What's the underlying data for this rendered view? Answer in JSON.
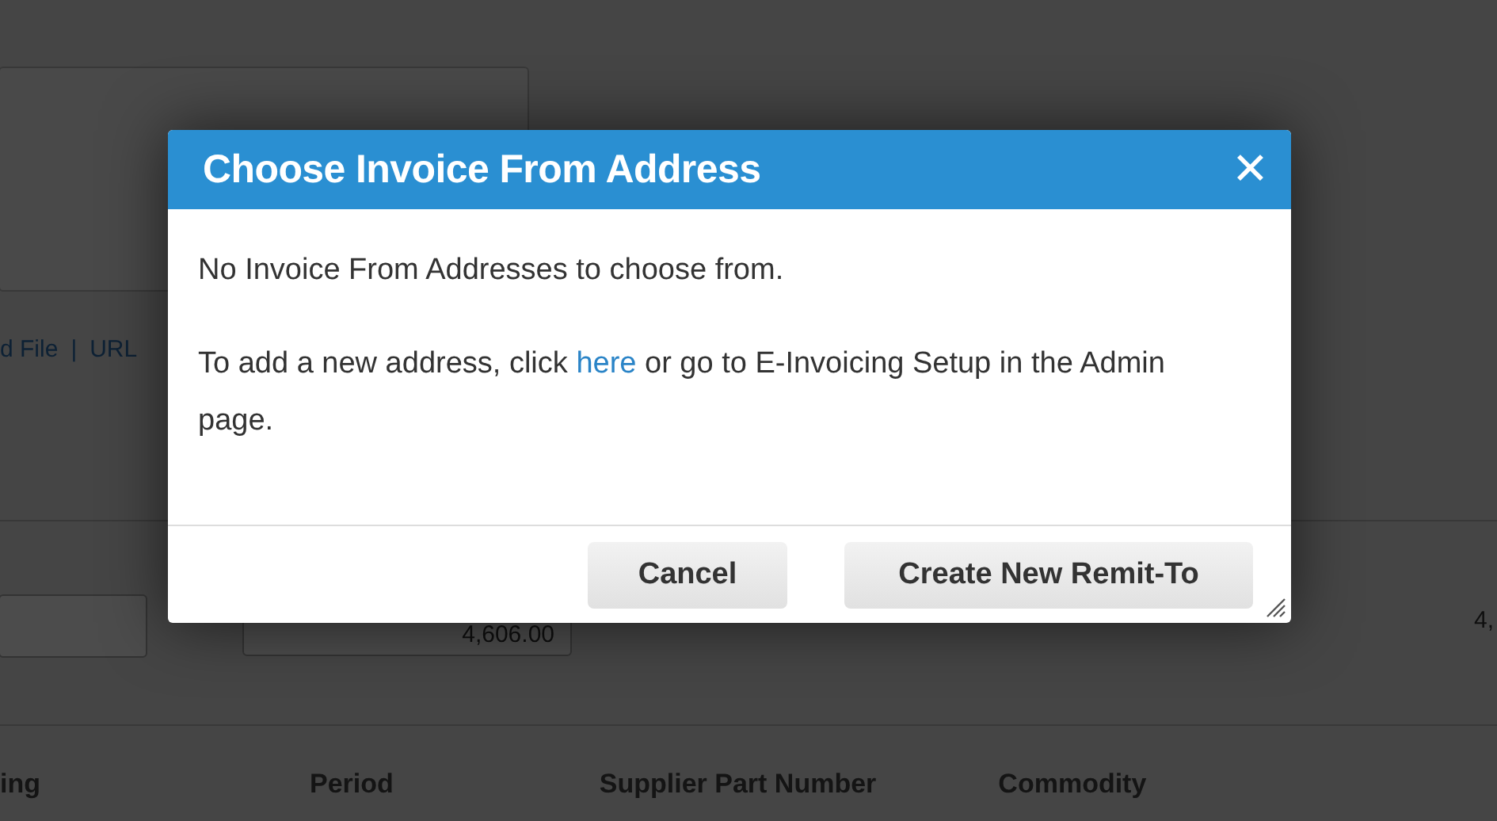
{
  "background": {
    "links": [
      {
        "label": "d File"
      },
      {
        "label": "URL"
      }
    ],
    "link_separator": "|",
    "amount_field": {
      "value": "4,606.00"
    },
    "total": "4,",
    "columns": [
      "ing",
      "Period",
      "Supplier Part Number",
      "Commodity"
    ]
  },
  "dialog": {
    "title": "Choose Invoice From Address",
    "close": "✕",
    "message": "No Invoice From Addresses to choose from.",
    "instruction": {
      "before": "To add a new address, click ",
      "link": "here",
      "after": " or go to E-Invoicing Setup in the Admin page."
    },
    "buttons": [
      {
        "label": "Cancel"
      },
      {
        "label": "Create New Remit-To"
      }
    ]
  }
}
